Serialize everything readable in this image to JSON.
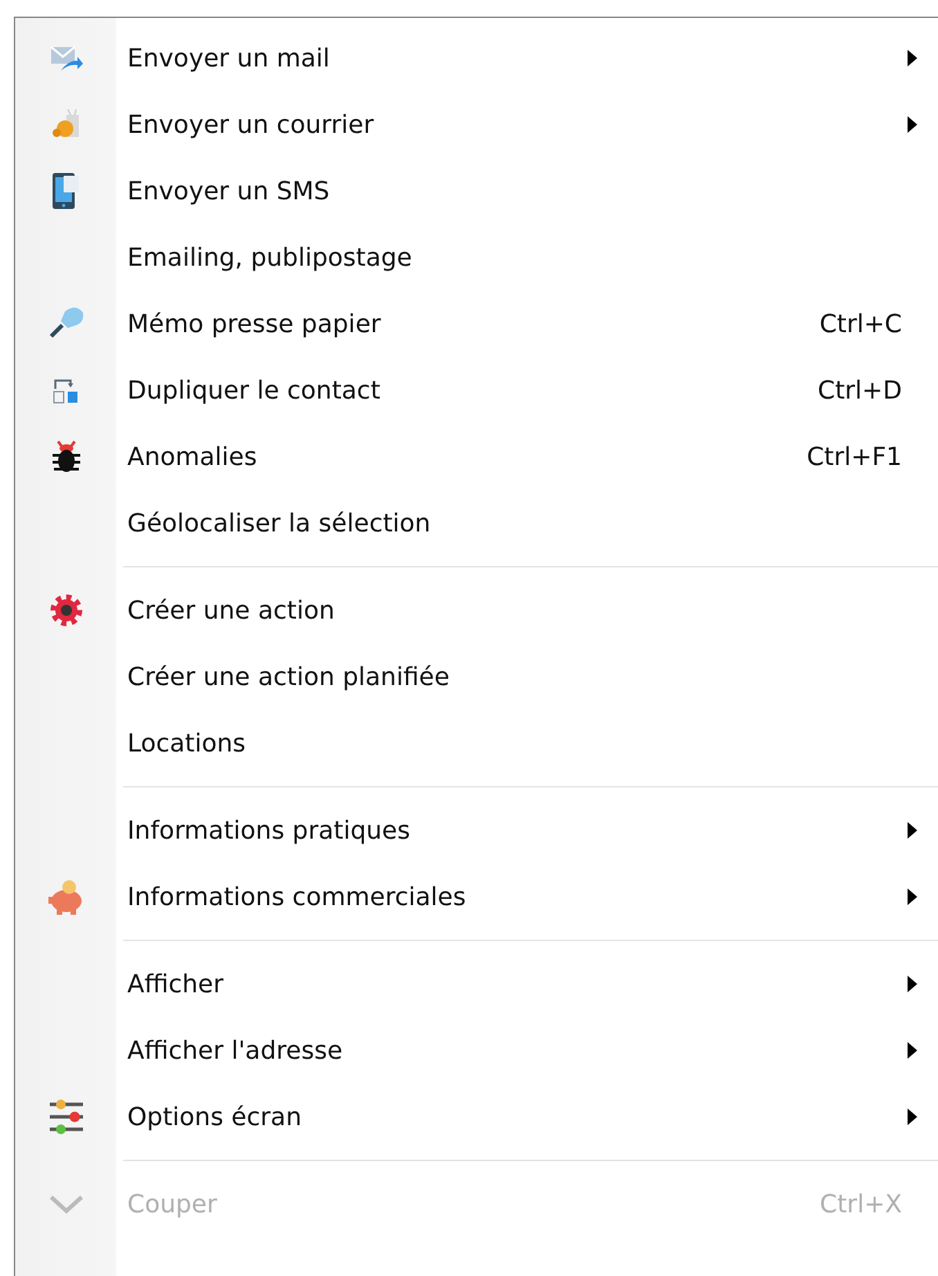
{
  "menu": {
    "sections": [
      {
        "items": [
          {
            "label": "Envoyer un mail",
            "kind": "mail",
            "submenu": true,
            "disabled": false
          },
          {
            "label": "Envoyer un courrier",
            "kind": "snail",
            "submenu": true,
            "disabled": false
          },
          {
            "label": "Envoyer un SMS",
            "kind": "phone",
            "submenu": false,
            "disabled": false
          },
          {
            "label": "Emailing, publipostage",
            "kind": "plain",
            "submenu": false,
            "disabled": false
          },
          {
            "label": "Mémo presse papier",
            "kind": "pin",
            "shortcut": "Ctrl+C",
            "submenu": false,
            "disabled": false
          },
          {
            "label": "Dupliquer le contact",
            "kind": "duplicate",
            "shortcut": "Ctrl+D",
            "submenu": false,
            "disabled": false
          },
          {
            "label": "Anomalies",
            "kind": "bug",
            "shortcut": "Ctrl+F1",
            "submenu": false,
            "disabled": false
          },
          {
            "label": "Géolocaliser la sélection",
            "kind": "plain",
            "submenu": false,
            "disabled": false
          }
        ]
      },
      {
        "items": [
          {
            "label": "Créer une action",
            "kind": "gear",
            "submenu": false,
            "disabled": false
          },
          {
            "label": "Créer une action planifiée",
            "kind": "plain",
            "submenu": false,
            "disabled": false
          },
          {
            "label": "Locations",
            "kind": "plain",
            "submenu": false,
            "disabled": false
          }
        ]
      },
      {
        "items": [
          {
            "label": "Informations pratiques",
            "kind": "plain",
            "submenu": true,
            "disabled": false
          },
          {
            "label": "Informations commerciales",
            "kind": "piggy",
            "submenu": true,
            "disabled": false
          }
        ]
      },
      {
        "items": [
          {
            "label": "Afficher",
            "kind": "plain",
            "submenu": true,
            "disabled": false
          },
          {
            "label": "Afficher l'adresse",
            "kind": "plain",
            "submenu": true,
            "disabled": false
          },
          {
            "label": "Options écran",
            "kind": "sliders",
            "submenu": true,
            "disabled": false
          }
        ]
      },
      {
        "items": [
          {
            "label": "Couper",
            "kind": "cut",
            "shortcut": "Ctrl+X",
            "submenu": false,
            "disabled": true
          }
        ]
      }
    ]
  }
}
